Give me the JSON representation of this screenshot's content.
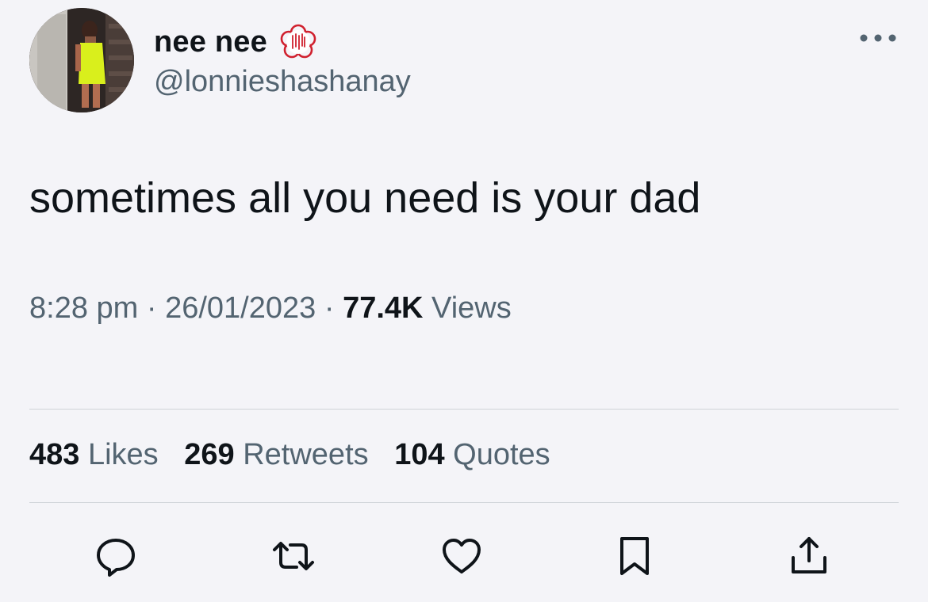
{
  "author": {
    "display_name": "nee nee",
    "handle": "@lonnieshashanay",
    "avatar_icon": "profile-photo",
    "badge_icon": "red-stamp-badge-icon"
  },
  "tweet": {
    "text": "sometimes all you need is your dad",
    "time": "8:28 pm",
    "date": "26/01/2023",
    "separator": "·",
    "views_count": "77.4K",
    "views_label": "Views"
  },
  "stats": {
    "likes_count": "483",
    "likes_label": "Likes",
    "retweets_count": "269",
    "retweets_label": "Retweets",
    "quotes_count": "104",
    "quotes_label": "Quotes"
  },
  "actions": [
    {
      "name": "reply",
      "icon": "reply-icon"
    },
    {
      "name": "retweet",
      "icon": "retweet-icon"
    },
    {
      "name": "like",
      "icon": "heart-icon"
    },
    {
      "name": "bookmark",
      "icon": "bookmark-icon"
    },
    {
      "name": "share",
      "icon": "share-icon"
    }
  ],
  "colors": {
    "background": "#f4f4f8",
    "text_primary": "#0f1419",
    "text_secondary": "#536471",
    "divider": "#cfd3d8",
    "badge_red": "#d0202e"
  }
}
